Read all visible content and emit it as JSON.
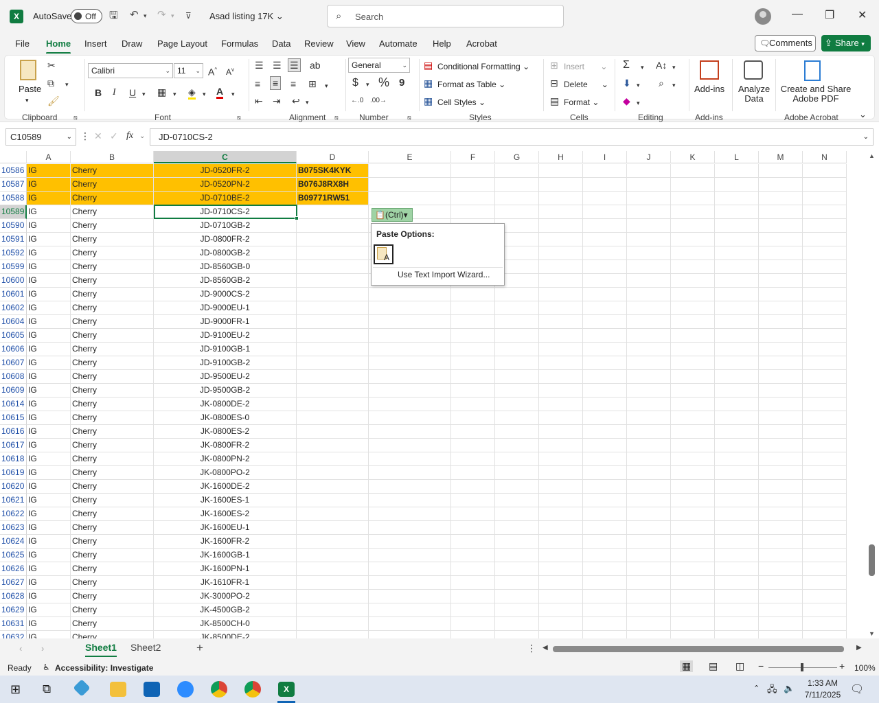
{
  "app": {
    "logo_letter": "X",
    "autosave_label": "AutoSave",
    "autosave_state": "Off",
    "doc_title": "Asad listing 17K",
    "search_placeholder": "Search"
  },
  "menu": {
    "tabs": [
      "File",
      "Home",
      "Insert",
      "Draw",
      "Page Layout",
      "Formulas",
      "Data",
      "Review",
      "View",
      "Automate",
      "Help",
      "Acrobat"
    ],
    "active": "Home",
    "comments": "Comments",
    "share": "Share"
  },
  "ribbon": {
    "clipboard": {
      "paste": "Paste",
      "label": "Clipboard"
    },
    "font": {
      "name": "Calibri",
      "size": "11",
      "label": "Font",
      "bold": "B",
      "italic": "I",
      "underline": "U"
    },
    "alignment": {
      "label": "Alignment"
    },
    "number": {
      "format": "General",
      "label": "Number",
      "currency": "$",
      "percent": "%",
      "comma": "9"
    },
    "styles": {
      "conditional": "Conditional Formatting",
      "table": "Format as Table",
      "cell_styles": "Cell Styles",
      "label": "Styles"
    },
    "cells": {
      "insert": "Insert",
      "delete": "Delete",
      "format": "Format",
      "label": "Cells"
    },
    "editing": {
      "label": "Editing"
    },
    "addins": {
      "addins": "Add-ins",
      "label": "Add-ins"
    },
    "analyze": {
      "line1": "Analyze",
      "line2": "Data"
    },
    "acrobat": {
      "line1": "Create and Share",
      "line2": "Adobe PDF",
      "label": "Adobe Acrobat"
    }
  },
  "formula_bar": {
    "name_box": "C10589",
    "formula": "JD-0710CS-2"
  },
  "columns": [
    "A",
    "B",
    "C",
    "D",
    "E",
    "F",
    "G",
    "H",
    "I",
    "J",
    "K",
    "L",
    "M",
    "N"
  ],
  "selected_column": "C",
  "rows": [
    {
      "n": "10586",
      "a": "IG",
      "b": "Cherry",
      "c": "JD-0520FR-2",
      "d": "B075SK4KYK",
      "hl": true
    },
    {
      "n": "10587",
      "a": "IG",
      "b": "Cherry",
      "c": "JD-0520PN-2",
      "d": "B076J8RX8H",
      "hl": true
    },
    {
      "n": "10588",
      "a": "IG",
      "b": "Cherry",
      "c": "JD-0710BE-2",
      "d": "B09771RW51",
      "hl": true
    },
    {
      "n": "10589",
      "a": "IG",
      "b": "Cherry",
      "c": "JD-0710CS-2",
      "d": "",
      "sel": true
    },
    {
      "n": "10590",
      "a": "IG",
      "b": "Cherry",
      "c": "JD-0710GB-2",
      "d": ""
    },
    {
      "n": "10591",
      "a": "IG",
      "b": "Cherry",
      "c": "JD-0800FR-2",
      "d": ""
    },
    {
      "n": "10592",
      "a": "IG",
      "b": "Cherry",
      "c": "JD-0800GB-2",
      "d": ""
    },
    {
      "n": "10599",
      "a": "IG",
      "b": "Cherry",
      "c": "JD-8560GB-0",
      "d": ""
    },
    {
      "n": "10600",
      "a": "IG",
      "b": "Cherry",
      "c": "JD-8560GB-2",
      "d": ""
    },
    {
      "n": "10601",
      "a": "IG",
      "b": "Cherry",
      "c": "JD-9000CS-2",
      "d": ""
    },
    {
      "n": "10602",
      "a": "IG",
      "b": "Cherry",
      "c": "JD-9000EU-1",
      "d": ""
    },
    {
      "n": "10604",
      "a": "IG",
      "b": "Cherry",
      "c": "JD-9000FR-1",
      "d": ""
    },
    {
      "n": "10605",
      "a": "IG",
      "b": "Cherry",
      "c": "JD-9100EU-2",
      "d": ""
    },
    {
      "n": "10606",
      "a": "IG",
      "b": "Cherry",
      "c": "JD-9100GB-1",
      "d": ""
    },
    {
      "n": "10607",
      "a": "IG",
      "b": "Cherry",
      "c": "JD-9100GB-2",
      "d": ""
    },
    {
      "n": "10608",
      "a": "IG",
      "b": "Cherry",
      "c": "JD-9500EU-2",
      "d": ""
    },
    {
      "n": "10609",
      "a": "IG",
      "b": "Cherry",
      "c": "JD-9500GB-2",
      "d": ""
    },
    {
      "n": "10614",
      "a": "IG",
      "b": "Cherry",
      "c": "JK-0800DE-2",
      "d": ""
    },
    {
      "n": "10615",
      "a": "IG",
      "b": "Cherry",
      "c": "JK-0800ES-0",
      "d": ""
    },
    {
      "n": "10616",
      "a": "IG",
      "b": "Cherry",
      "c": "JK-0800ES-2",
      "d": ""
    },
    {
      "n": "10617",
      "a": "IG",
      "b": "Cherry",
      "c": "JK-0800FR-2",
      "d": ""
    },
    {
      "n": "10618",
      "a": "IG",
      "b": "Cherry",
      "c": "JK-0800PN-2",
      "d": ""
    },
    {
      "n": "10619",
      "a": "IG",
      "b": "Cherry",
      "c": "JK-0800PO-2",
      "d": ""
    },
    {
      "n": "10620",
      "a": "IG",
      "b": "Cherry",
      "c": "JK-1600DE-2",
      "d": ""
    },
    {
      "n": "10621",
      "a": "IG",
      "b": "Cherry",
      "c": "JK-1600ES-1",
      "d": ""
    },
    {
      "n": "10622",
      "a": "IG",
      "b": "Cherry",
      "c": "JK-1600ES-2",
      "d": ""
    },
    {
      "n": "10623",
      "a": "IG",
      "b": "Cherry",
      "c": "JK-1600EU-1",
      "d": ""
    },
    {
      "n": "10624",
      "a": "IG",
      "b": "Cherry",
      "c": "JK-1600FR-2",
      "d": ""
    },
    {
      "n": "10625",
      "a": "IG",
      "b": "Cherry",
      "c": "JK-1600GB-1",
      "d": ""
    },
    {
      "n": "10626",
      "a": "IG",
      "b": "Cherry",
      "c": "JK-1600PN-1",
      "d": ""
    },
    {
      "n": "10627",
      "a": "IG",
      "b": "Cherry",
      "c": "JK-1610FR-1",
      "d": ""
    },
    {
      "n": "10628",
      "a": "IG",
      "b": "Cherry",
      "c": "JK-3000PO-2",
      "d": ""
    },
    {
      "n": "10629",
      "a": "IG",
      "b": "Cherry",
      "c": "JK-4500GB-2",
      "d": ""
    },
    {
      "n": "10631",
      "a": "IG",
      "b": "Cherry",
      "c": "JK-8500CH-0",
      "d": ""
    },
    {
      "n": "10632",
      "a": "IG",
      "b": "Cherry",
      "c": "JK-8500DE-2",
      "d": ""
    }
  ],
  "paste_popup": {
    "button": "(Ctrl)",
    "title": "Paste Options:",
    "wizard": "Use Text Import Wizard..."
  },
  "sheets": {
    "tabs": [
      "Sheet1",
      "Sheet2"
    ],
    "active": "Sheet1"
  },
  "status": {
    "ready": "Ready",
    "accessibility": "Accessibility: Investigate",
    "zoom": "100%"
  },
  "taskbar": {
    "time": "1:33 AM",
    "date": "7/11/2025"
  },
  "colors": {
    "accent": "#107c41",
    "highlight": "#ffc000"
  }
}
